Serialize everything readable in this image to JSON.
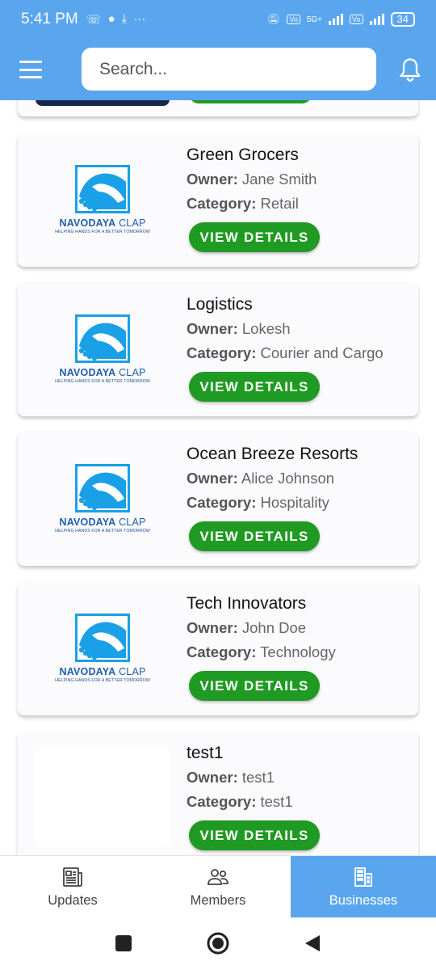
{
  "status_bar": {
    "time": "5:41 PM",
    "icons_left": [
      "missed-call-icon",
      "chat-icon",
      "download-icon",
      "more-dots-icon"
    ],
    "network_label": "5G+",
    "battery": "34"
  },
  "header": {
    "search_placeholder": "Search..."
  },
  "businesses": [
    {
      "name": "Green Grocers",
      "owner_label": "Owner:",
      "owner": "Jane Smith",
      "category_label": "Category:",
      "category": "Retail",
      "button": "VIEW DETAILS",
      "logo": "navodaya"
    },
    {
      "name": "Logistics",
      "owner_label": "Owner:",
      "owner": "Lokesh",
      "category_label": "Category:",
      "category": "Courier and Cargo",
      "button": "VIEW DETAILS",
      "logo": "navodaya"
    },
    {
      "name": "Ocean Breeze Resorts",
      "owner_label": "Owner:",
      "owner": "Alice Johnson",
      "category_label": "Category:",
      "category": "Hospitality",
      "button": "VIEW DETAILS",
      "logo": "navodaya"
    },
    {
      "name": "Tech Innovators",
      "owner_label": "Owner:",
      "owner": "John Doe",
      "category_label": "Category:",
      "category": "Technology",
      "button": "VIEW DETAILS",
      "logo": "navodaya"
    },
    {
      "name": "test1",
      "owner_label": "Owner:",
      "owner": "test1",
      "category_label": "Category:",
      "category": "test1",
      "button": "VIEW DETAILS",
      "logo": "blank"
    }
  ],
  "logo": {
    "title_bold": "NAVODAYA",
    "title_light": " CLAP",
    "tagline": "HELPING HANDS FOR A BETTER TOMORROW"
  },
  "bottom_nav": [
    {
      "label": "Updates",
      "icon": "newspaper-icon",
      "active": false
    },
    {
      "label": "Members",
      "icon": "people-icon",
      "active": false
    },
    {
      "label": "Businesses",
      "icon": "building-icon",
      "active": true
    }
  ],
  "colors": {
    "primary": "#5aa6ee",
    "button_green": "#1f9a22",
    "logo_blue": "#1f5fab",
    "logo_sky": "#1aa0e6"
  }
}
